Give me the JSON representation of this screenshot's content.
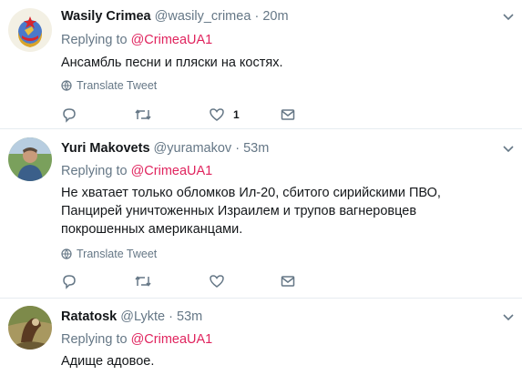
{
  "tweets": [
    {
      "name": "Wasily Crimea",
      "handle": "@wasily_crimea",
      "separator": "·",
      "time": "20m",
      "replying_prefix": "Replying to",
      "replying_to": "@CrimeaUA1",
      "text": "Ансамбль песни и пляски на костях.",
      "translate_label": "Translate Tweet",
      "like_count": "1"
    },
    {
      "name": "Yuri Makovets",
      "handle": "@yuramakov",
      "separator": "·",
      "time": "53m",
      "replying_prefix": "Replying to",
      "replying_to": "@CrimeaUA1",
      "text": "Не хватает только обломков Ил-20, сбитого сирийскими ПВО, Панцирей уничтоженных Израилем и трупов вагнеровцев покрошенных американцами.",
      "translate_label": "Translate Tweet",
      "like_count": ""
    },
    {
      "name": "Ratatosk",
      "handle": "@Lykte",
      "separator": "·",
      "time": "53m",
      "replying_prefix": "Replying to",
      "replying_to": "@CrimeaUA1",
      "text": "Адище адовое.",
      "translate_label": "",
      "like_count": ""
    }
  ],
  "colors": {
    "text": "#14171a",
    "secondary": "#657786",
    "mention": "#e0245e",
    "divider": "#e6ecf0"
  }
}
